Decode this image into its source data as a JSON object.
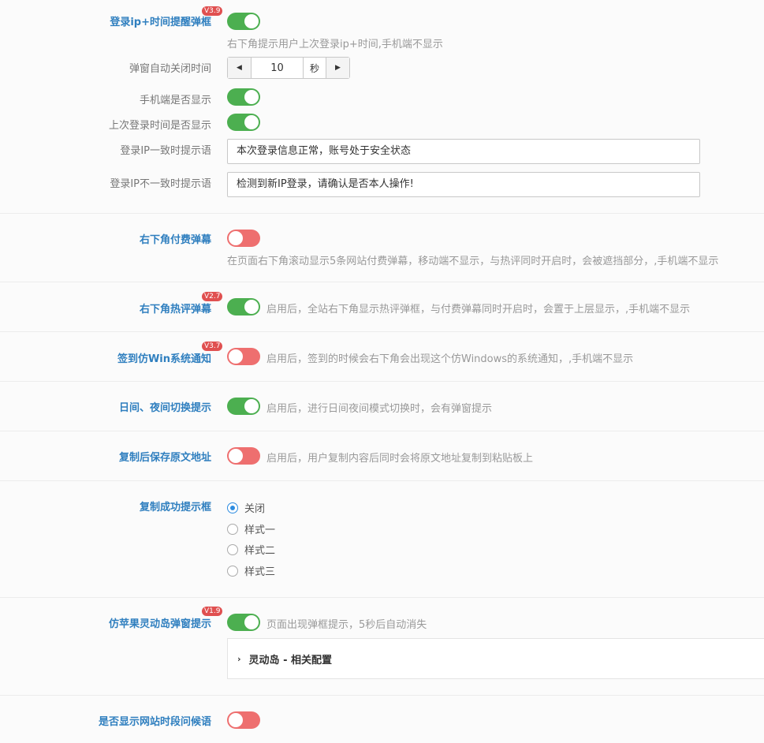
{
  "login_ip_popup": {
    "label": "登录ip+时间提醒弹框",
    "badge": "V3.9",
    "desc": "右下角提示用户上次登录ip+时间,手机端不显示"
  },
  "auto_close": {
    "label": "弹窗自动关闭时间",
    "value": "10",
    "unit": "秒"
  },
  "mobile_show": {
    "label": "手机端是否显示"
  },
  "last_login_show": {
    "label": "上次登录时间是否显示"
  },
  "ip_match_tip": {
    "label": "登录IP一致时提示语",
    "value": "本次登录信息正常，账号处于安全状态"
  },
  "ip_mismatch_tip": {
    "label": "登录IP不一致时提示语",
    "value": "检测到新IP登录，请确认是否本人操作!"
  },
  "paid_barrage": {
    "label": "右下角付费弹幕",
    "desc": "在页面右下角滚动显示5条网站付费弹幕，移动端不显示，与热评同时开启时，会被遮挡部分，,手机端不显示"
  },
  "hot_comment": {
    "label": "右下角热评弹幕",
    "badge": "V2.7",
    "desc": "启用后，全站右下角显示热评弹框，与付费弹幕同时开启时，会置于上层显示，,手机端不显示"
  },
  "win_notify": {
    "label": "签到仿Win系统通知",
    "badge": "V3.7",
    "desc": "启用后，签到的时候会右下角会出现这个仿Windows的系统通知，,手机端不显示"
  },
  "day_night": {
    "label": "日间、夜间切换提示",
    "desc": "启用后，进行日间夜间模式切换时，会有弹窗提示"
  },
  "copy_source": {
    "label": "复制后保存原文地址",
    "desc": "启用后，用户复制内容后同时会将原文地址复制到粘贴板上"
  },
  "copy_success": {
    "label": "复制成功提示框",
    "options": [
      "关闭",
      "样式一",
      "样式二",
      "样式三"
    ],
    "selected": "关闭"
  },
  "dynamic_island": {
    "label": "仿苹果灵动岛弹窗提示",
    "badge": "V1.9",
    "desc": "页面出现弹框提示，5秒后自动消失",
    "config_title": "灵动岛 - 相关配置"
  },
  "greeting": {
    "label": "是否显示网站时段问候语"
  },
  "colors": {
    "toggle_on": "#4caf50",
    "toggle_off": "#ee6f6f",
    "label_blue": "#2f7fbf",
    "badge_red": "#e05050",
    "radio_blue": "#2d8ce0"
  },
  "icons": {
    "stepper_left": "▶",
    "stepper_right": "▶",
    "chevron": "›"
  }
}
